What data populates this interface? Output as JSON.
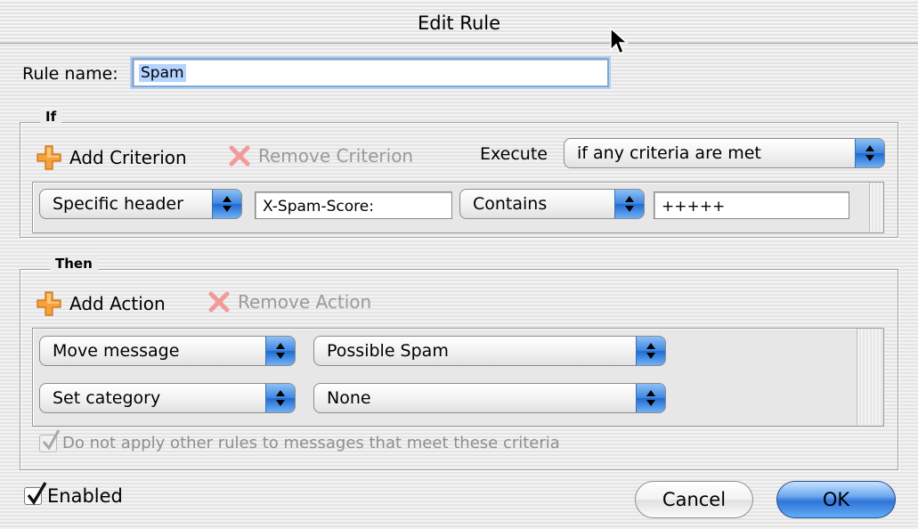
{
  "window": {
    "title": "Edit Rule"
  },
  "rule": {
    "name_label": "Rule name:",
    "name_value": "Spam"
  },
  "if_group": {
    "title": "If",
    "add_label": "Add Criterion",
    "remove_label": "Remove Criterion",
    "execute_label": "Execute",
    "execute_value": "if any criteria are met",
    "criteria": [
      {
        "type": "Specific header",
        "header": "X-Spam-Score:",
        "operator": "Contains",
        "value": "+++++"
      }
    ]
  },
  "then_group": {
    "title": "Then",
    "add_label": "Add Action",
    "remove_label": "Remove Action",
    "actions": [
      {
        "action": "Move message",
        "target": "Possible Spam"
      },
      {
        "action": "Set category",
        "target": "None"
      }
    ],
    "stop_rules_label": "Do not apply other rules to messages that meet these criteria",
    "stop_rules_checked": true
  },
  "footer": {
    "enabled_label": "Enabled",
    "enabled_checked": true,
    "cancel_label": "Cancel",
    "ok_label": "OK"
  },
  "icons": {
    "add": "plus-icon",
    "remove": "x-icon",
    "popup": "up-down-arrows-icon",
    "check": "checkmark-icon",
    "cursor": "mouse-pointer-icon"
  },
  "colors": {
    "accent": "#3d86e0",
    "plus": "#f0932b",
    "remove_x": "#f29a9a",
    "selection": "#b5d3ff"
  }
}
